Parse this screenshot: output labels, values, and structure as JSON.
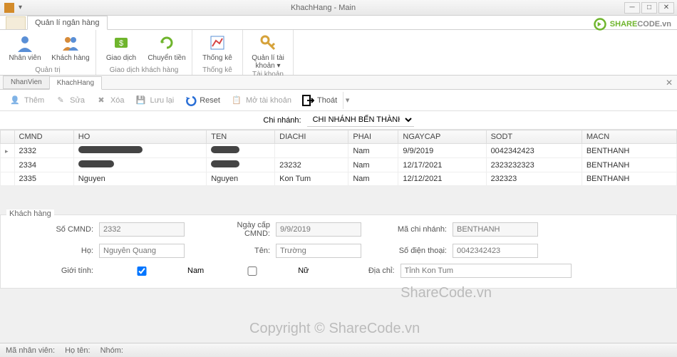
{
  "window": {
    "title": "KhachHang - Main"
  },
  "brand": {
    "green": "SHARE",
    "dark": "CODE",
    "suffix": ".vn"
  },
  "ribbon_tab": "Quản lí ngân hàng",
  "ribbon": {
    "groups": [
      {
        "name": "Quản trị",
        "buttons": [
          {
            "label": "Nhân viên",
            "icon": "user"
          },
          {
            "label": "Khách hàng",
            "icon": "users"
          }
        ]
      },
      {
        "name": "Giao dịch khách hàng",
        "buttons": [
          {
            "label": "Giao dịch",
            "icon": "money"
          },
          {
            "label": "Chuyển tiền",
            "icon": "cycle"
          }
        ]
      },
      {
        "name": "Thống kê",
        "buttons": [
          {
            "label": "Thống kê",
            "icon": "chart"
          }
        ]
      },
      {
        "name": "Tài khoản",
        "buttons": [
          {
            "label": "Quản lí tài khoản ▾",
            "icon": "key"
          }
        ]
      }
    ]
  },
  "doctabs": [
    {
      "label": "NhanVien",
      "active": false
    },
    {
      "label": "KhachHang",
      "active": true
    }
  ],
  "toolbar": {
    "them": "Thêm",
    "sua": "Sửa",
    "xoa": "Xóa",
    "luu": "Lưu lại",
    "reset": "Reset",
    "motk": "Mở tài khoản",
    "thoat": "Thoát"
  },
  "branch": {
    "label": "Chi nhánh:",
    "value": "CHI NHÁNH BẾN THÀNH"
  },
  "grid": {
    "cols": [
      "CMND",
      "HO",
      "TEN",
      "DIACHI",
      "PHAI",
      "NGAYCAP",
      "SODT",
      "MACN"
    ],
    "rows": [
      {
        "cmnd": "2332",
        "ho": "████████",
        "ten": "████",
        "diachi": "",
        "phai": "Nam",
        "ngaycap": "9/9/2019",
        "sodt": "0042342423",
        "macn": "BENTHANH",
        "redact": true
      },
      {
        "cmnd": "2334",
        "ho": "████",
        "ten": "████",
        "diachi": "23232",
        "phai": "Nam",
        "ngaycap": "12/17/2021",
        "sodt": "2323232323",
        "macn": "BENTHANH",
        "redact": true
      },
      {
        "cmnd": "2335",
        "ho": "Nguyen",
        "ten": "Nguyen",
        "diachi": "Kon Tum",
        "phai": "Nam",
        "ngaycap": "12/12/2021",
        "sodt": "232323",
        "macn": "BENTHANH",
        "redact": false
      }
    ]
  },
  "form": {
    "title": "Khách hàng",
    "labels": {
      "cmnd": "Số CMND:",
      "ngaycap": "Ngày cấp CMND:",
      "macn": "Mã chi nhánh:",
      "ho": "Họ:",
      "ten": "Tên:",
      "sodt": "Số điện thoại:",
      "gioitinh": "Giới tính:",
      "nam": "Nam",
      "nu": "Nữ",
      "diachi": "Địa chỉ:"
    },
    "values": {
      "cmnd": "2332",
      "ngaycap": "9/9/2019",
      "macn": "BENTHANH",
      "ho": "Nguyễn Quang",
      "ten": "Trường",
      "sodt": "0042342423",
      "diachi": "Tỉnh Kon Tum"
    }
  },
  "watermarks": {
    "a": "ShareCode.vn",
    "b": "Copyright © ShareCode.vn"
  },
  "status": {
    "manv": "Mã nhân viên:",
    "hoten": "Họ tên:",
    "nhom": "Nhóm:"
  }
}
